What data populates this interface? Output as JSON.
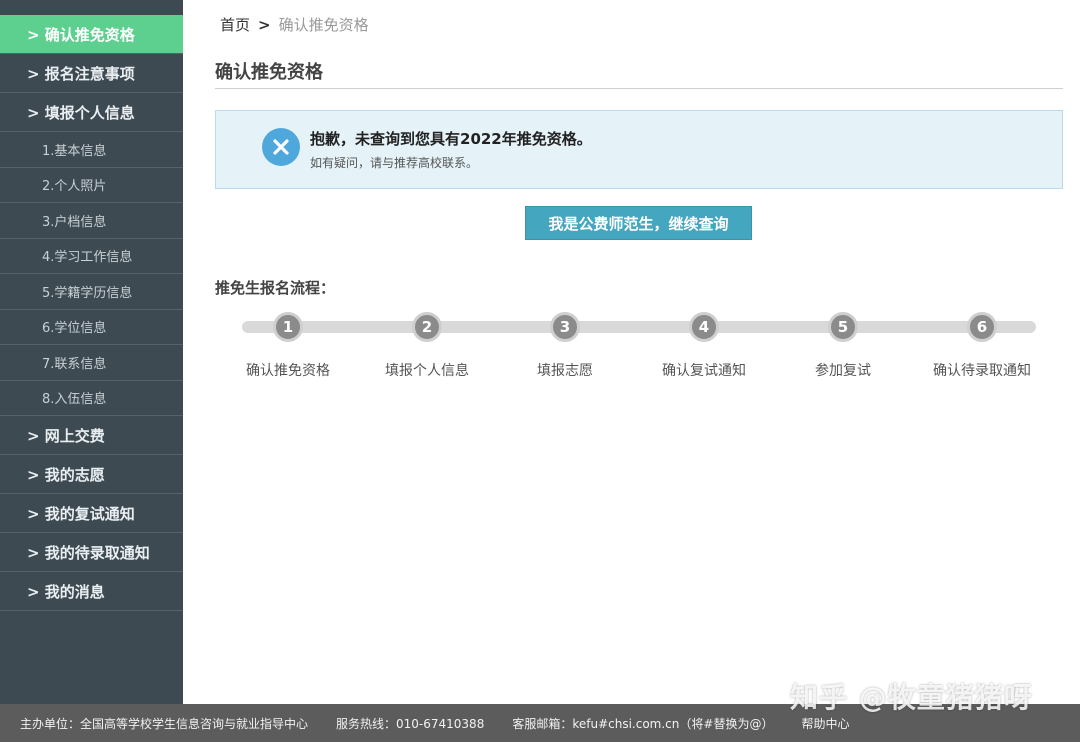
{
  "sidebar": {
    "items": [
      {
        "label": "> 确认推免资格",
        "level": 1,
        "active": true
      },
      {
        "label": "> 报名注意事项",
        "level": 1
      },
      {
        "label": "> 填报个人信息",
        "level": 1
      },
      {
        "label": "1.基本信息",
        "level": 2
      },
      {
        "label": "2.个人照片",
        "level": 2
      },
      {
        "label": "3.户档信息",
        "level": 2
      },
      {
        "label": "4.学习工作信息",
        "level": 2
      },
      {
        "label": "5.学籍学历信息",
        "level": 2
      },
      {
        "label": "6.学位信息",
        "level": 2
      },
      {
        "label": "7.联系信息",
        "level": 2
      },
      {
        "label": "8.入伍信息",
        "level": 2
      },
      {
        "label": "> 网上交费",
        "level": 1
      },
      {
        "label": "> 我的志愿",
        "level": 1
      },
      {
        "label": "> 我的复试通知",
        "level": 1
      },
      {
        "label": "> 我的待录取通知",
        "level": 1
      },
      {
        "label": "> 我的消息",
        "level": 1
      }
    ]
  },
  "breadcrumb": {
    "home": "首页",
    "separator": ">",
    "current": "确认推免资格"
  },
  "page": {
    "title": "确认推免资格"
  },
  "alert": {
    "message": "抱歉，未查询到您具有2022年推免资格。",
    "sub": "如有疑问，请与推荐高校联系。",
    "icon": "close-circle-icon",
    "icon_color": "#4ea8dc"
  },
  "continue_button": {
    "label": "我是公费师范生，继续查询"
  },
  "flow": {
    "heading": "推免生报名流程：",
    "steps": [
      {
        "num": "1",
        "label": "确认推免资格"
      },
      {
        "num": "2",
        "label": "填报个人信息"
      },
      {
        "num": "3",
        "label": "填报志愿"
      },
      {
        "num": "4",
        "label": "确认复试通知"
      },
      {
        "num": "5",
        "label": "参加复试"
      },
      {
        "num": "6",
        "label": "确认待录取通知"
      }
    ]
  },
  "footer": {
    "organizer": "主办单位：全国高等学校学生信息咨询与就业指导中心",
    "hotline": "服务热线：010-67410388",
    "email": "客服邮箱：kefu#chsi.com.cn（将#替换为@）",
    "help": "帮助中心"
  },
  "watermark": "知乎 @牧童猪猪呀",
  "colors": {
    "sidebar_bg": "#3e4a52",
    "active": "#5dcf8f",
    "button": "#45a7bf",
    "alert_bg": "#e5f2f8"
  }
}
